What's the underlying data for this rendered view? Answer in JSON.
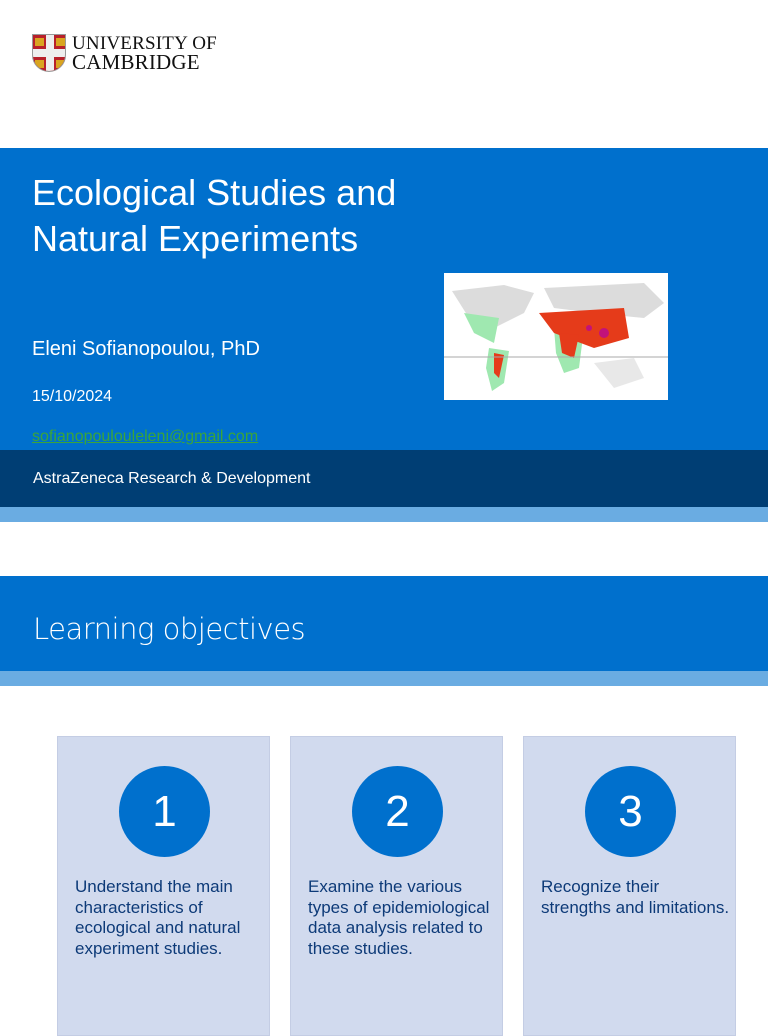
{
  "logo": {
    "line1": "UNIVERSITY OF",
    "line2": "CAMBRIDGE"
  },
  "hero": {
    "title_line1": "Ecological Studies and",
    "title_line2": "Natural Experiments",
    "author": "Eleni Sofianopoulou, PhD",
    "date": "15/10/2024",
    "email": "sofianopoulouleleni@gmail.com",
    "organization": "AstraZeneca Research & Development"
  },
  "section": {
    "title": "Learning objectives"
  },
  "objectives": [
    {
      "number": "1",
      "text": "Understand the main characteristics of ecological and natural experiment studies."
    },
    {
      "number": "2",
      "text": "Examine the various types of epidemiological data analysis related to these studies."
    },
    {
      "number": "3",
      "text": "Recognize their strengths and limitations."
    }
  ],
  "colors": {
    "primary": "#0070cd",
    "dark": "#003e74",
    "light": "#6aace2",
    "card": "#d1daee"
  }
}
